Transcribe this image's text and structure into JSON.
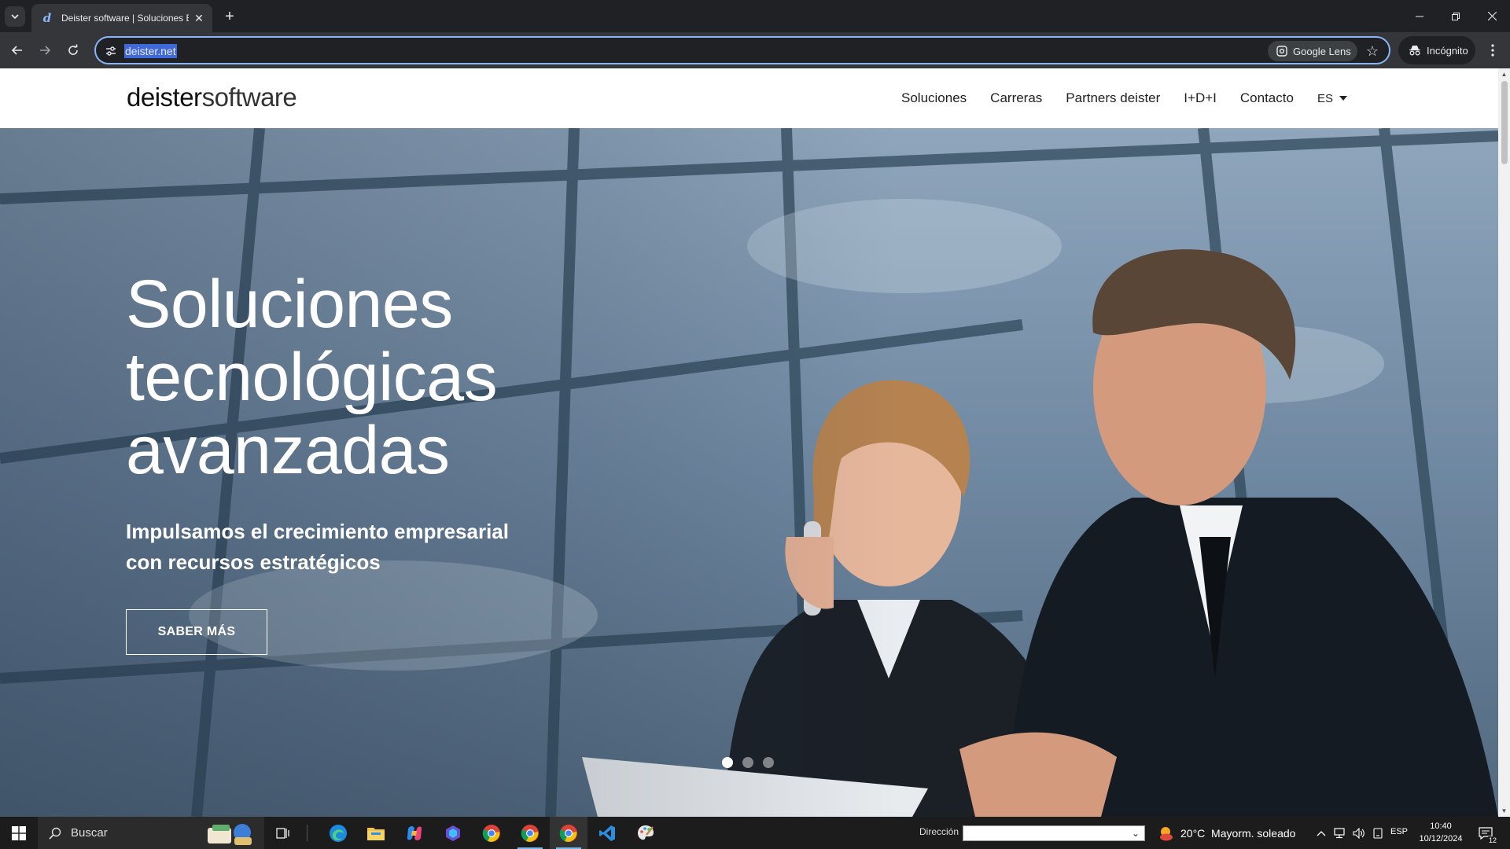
{
  "browser": {
    "tab": {
      "title": "Deister software | Soluciones ERP",
      "favicon": "deister-d-icon"
    },
    "omnibox": {
      "url": "deister.net",
      "lens_label": "Google Lens"
    },
    "incognito_label": "Incógnito"
  },
  "site": {
    "logo": {
      "strong": "deister",
      "light": "software"
    },
    "nav": [
      "Soluciones",
      "Carreras",
      "Partners deister",
      "I+D+I",
      "Contacto"
    ],
    "language": "ES"
  },
  "hero": {
    "title_lines": [
      "Soluciones",
      "tecnológicas",
      "avanzadas"
    ],
    "subtitle_lines": [
      "Impulsamos el crecimiento empresarial",
      "con recursos estratégicos"
    ],
    "cta": "SABER MÁS",
    "slides": {
      "count": 3,
      "active": 1
    }
  },
  "taskbar": {
    "search_placeholder": "Buscar",
    "address_label": "Dirección",
    "weather": "20°C  Mayorm. soleado",
    "language": "ESP",
    "time": "10:40",
    "date": "10/12/2024",
    "notifications": "12",
    "accent": "#76b9ed"
  }
}
